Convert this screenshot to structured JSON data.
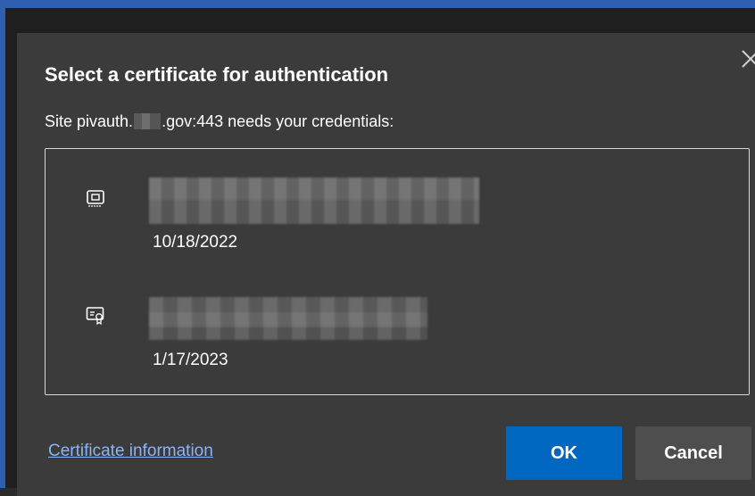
{
  "dialog": {
    "title": "Select a certificate for authentication",
    "site_prefix": "Site pivauth.",
    "site_suffix": ".gov:443 needs your credentials:",
    "close_icon": "close-icon"
  },
  "certificates": [
    {
      "icon": "smart-card-icon",
      "date": "10/18/2022"
    },
    {
      "icon": "certificate-icon",
      "date": "1/17/2023"
    }
  ],
  "footer": {
    "link_label": "Certificate information",
    "ok_label": "OK",
    "cancel_label": "Cancel"
  },
  "colors": {
    "accent": "#0067c0",
    "link": "#8ab4f8",
    "dialog_bg": "#3b3b3b",
    "window_border": "#2f5fb0"
  }
}
